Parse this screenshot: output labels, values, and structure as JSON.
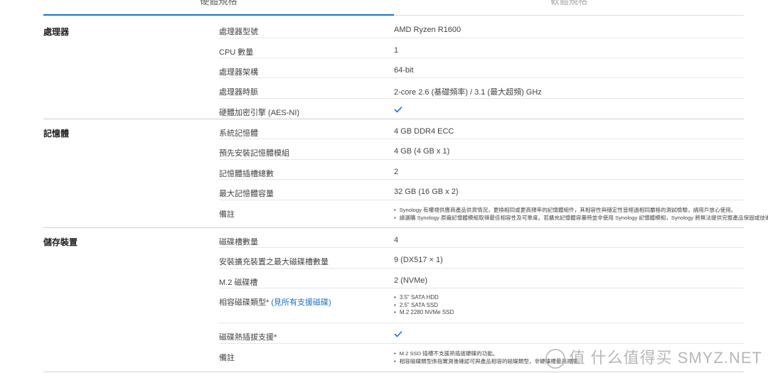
{
  "tabs": [
    {
      "label": "硬體規格"
    },
    {
      "label": "軟體規格"
    }
  ],
  "sections": [
    {
      "title": "處理器",
      "rows": [
        {
          "label": "處理器型號",
          "value": "AMD Ryzen R1600"
        },
        {
          "label": "CPU 數量",
          "value": "1"
        },
        {
          "label": "處理器架構",
          "value": "64-bit"
        },
        {
          "label": "處理器時脈",
          "value": "2-core 2.6 (基礎頻率) / 3.1 (最大超頻) GHz"
        },
        {
          "label": "硬體加密引擎 (AES-NI)",
          "value": "✓"
        }
      ]
    },
    {
      "title": "記憶體",
      "rows": [
        {
          "label": "系統記憶體",
          "value": "4 GB DDR4 ECC"
        },
        {
          "label": "預先安裝記憶體模組",
          "value": "4 GB (4 GB x 1)"
        },
        {
          "label": "記憶體插槽總數",
          "value": "2"
        },
        {
          "label": "最大記憶體容量",
          "value": "32 GB (16 GB x 2)"
        },
        {
          "label": "備註",
          "list": [
            "Synology 有權視供應商產品供貨情況，更換相同或更高頻率的記憶體組件，其相容性與穩定性皆經過相同嚴格的測試檢驗，請用戶放心使用。",
            "請選購 Synology 原廠記憶體模組取得最佳相容性及可靠度。若擴充記憶體容量時並非使用 Synology 記憶體模組，Synology 將無法提供完整產品保固或技術支援。"
          ]
        }
      ]
    },
    {
      "title": "儲存裝置",
      "rows": [
        {
          "label": "磁碟槽數量",
          "value": "4"
        },
        {
          "label": "安裝擴充裝置之最大磁碟槽數量",
          "value": "9 (DX517 × 1)"
        },
        {
          "label": "M.2 磁碟槽",
          "value": "2 (NVMe)"
        },
        {
          "label": "相容磁碟類型*",
          "link": "(見所有支援磁碟)",
          "list": [
            "3.5\" SATA HDD",
            "2.5\" SATA SSD",
            "M.2 2280 NVMe SSD"
          ]
        },
        {
          "label": "磁碟熱插拔支援*",
          "value": "✓"
        },
        {
          "label": "備註",
          "list": [
            "M.2 SSD 插槽不支援熱插拔硬碟的功能。",
            "相容磁碟類型係指實測後確認可與產品相容的磁碟類型，非硬碟槽最高規限。"
          ]
        }
      ]
    }
  ],
  "watermark": "值 什么值得买 SMYZ.NET",
  "colors": {
    "accent": "#1a73c8",
    "divider": "#e6e6e6"
  }
}
